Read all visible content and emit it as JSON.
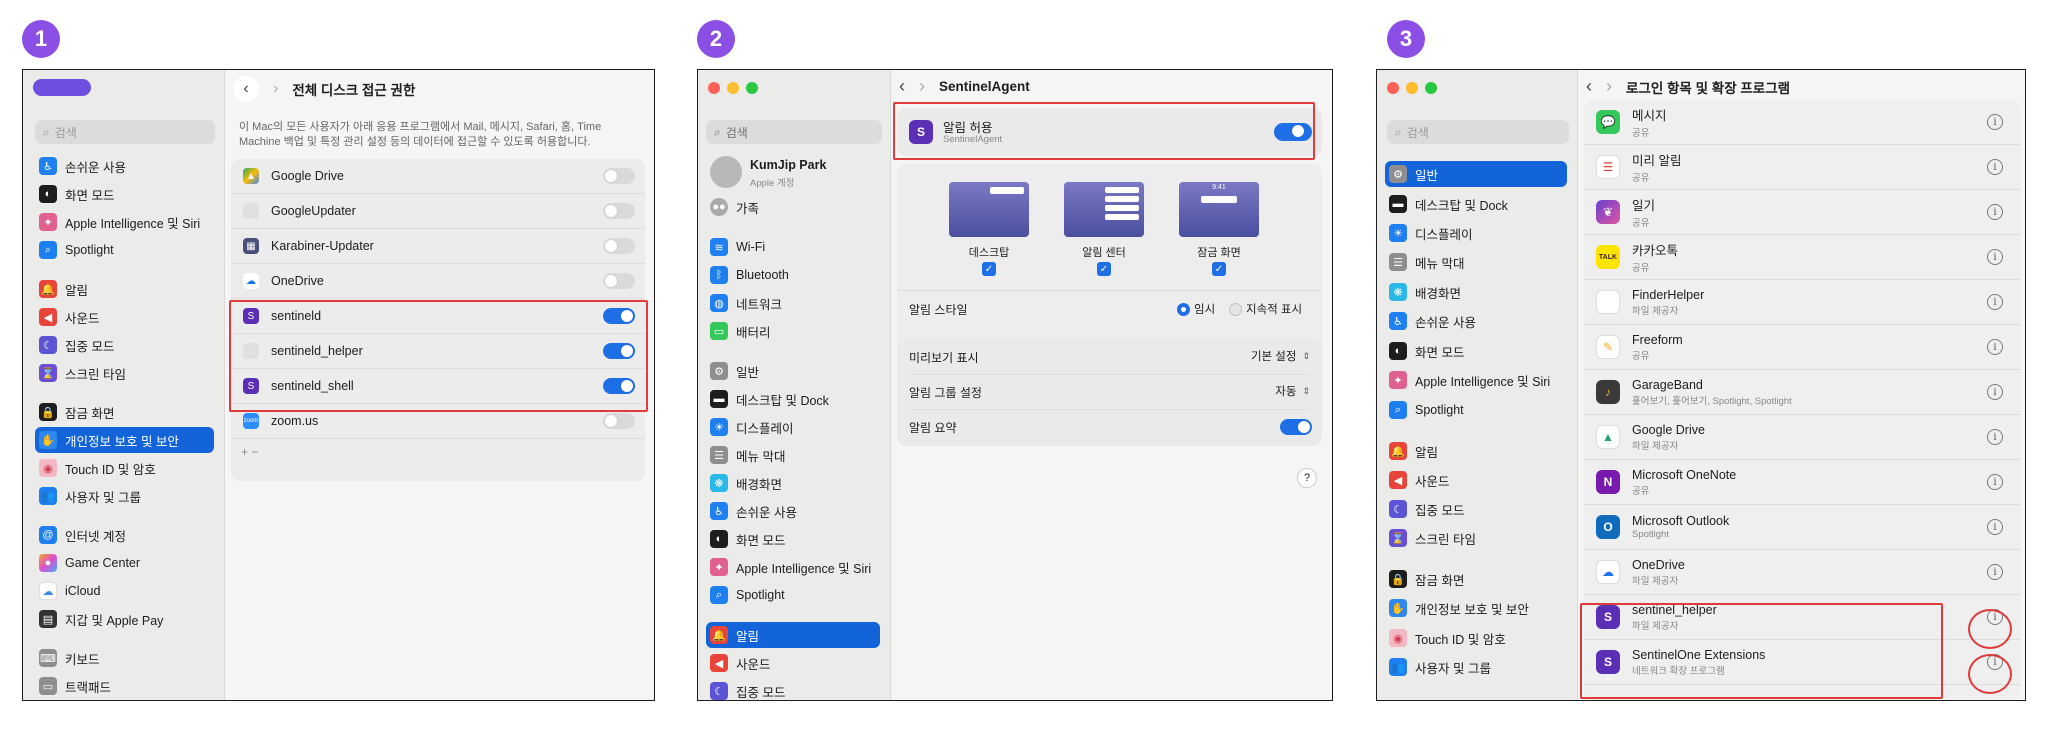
{
  "steps": [
    "1",
    "2",
    "3"
  ],
  "panel1": {
    "title": "전체 디스크 접근 권한",
    "search": "검색",
    "description": "이 Mac의 모든 사용자가 아래 응용 프로그램에서 Mail, 메시지, Safari, 홈, Time Machine 백업 및 특정 관리 설정 등의 데이터에 접근할 수 있도록 허용합니다.",
    "sidebar": [
      "손쉬운 사용",
      "화면 모드",
      "Apple Intelligence 및 Siri",
      "Spotlight",
      "알림",
      "사운드",
      "집중 모드",
      "스크린 타임",
      "잠금 화면",
      "개인정보 보호 및 보안",
      "Touch ID 및 암호",
      "사용자 및 그룹",
      "인터넷 계정",
      "Game Center",
      "iCloud",
      "지갑 및 Apple Pay",
      "키보드",
      "트랙패드"
    ],
    "apps": [
      {
        "name": "Google Drive",
        "on": false
      },
      {
        "name": "GoogleUpdater",
        "on": false
      },
      {
        "name": "Karabiner-Updater",
        "on": false
      },
      {
        "name": "OneDrive",
        "on": false
      },
      {
        "name": "sentineld",
        "on": true
      },
      {
        "name": "sentineld_helper",
        "on": true
      },
      {
        "name": "sentineld_shell",
        "on": true
      },
      {
        "name": "zoom.us",
        "on": false
      }
    ],
    "add_remove": "+   −"
  },
  "panel2": {
    "title": "SentinelAgent",
    "search": "검색",
    "user_name": "KumJip Park",
    "user_sub": "Apple 계정",
    "family": "가족",
    "sidebar": [
      "Wi-Fi",
      "Bluetooth",
      "네트워크",
      "배터리",
      "일반",
      "데스크탑 및 Dock",
      "디스플레이",
      "메뉴 막대",
      "배경화면",
      "손쉬운 사용",
      "화면 모드",
      "Apple Intelligence 및 Siri",
      "Spotlight",
      "알림",
      "사운드",
      "집중 모드"
    ],
    "allow_label": "알림 허용",
    "allow_sub": "SentinelAgent",
    "previews": [
      "데스크탑",
      "알림 센터",
      "잠금 화면"
    ],
    "preview_time": "9:41",
    "style_label": "알림 스타일",
    "style_opt1": "임시",
    "style_opt2": "지속적 표시",
    "show_preview_label": "미리보기 표시",
    "show_preview_value": "기본 설정",
    "grouping_label": "알림 그룹 설정",
    "grouping_value": "자동",
    "summary_label": "알림 요약",
    "help": "?"
  },
  "panel3": {
    "title": "로그인 항목 및 확장 프로그램",
    "search": "검색",
    "sidebar": [
      "일반",
      "데스크탑 및 Dock",
      "디스플레이",
      "메뉴 막대",
      "배경화면",
      "손쉬운 사용",
      "화면 모드",
      "Apple Intelligence 및 Siri",
      "Spotlight",
      "알림",
      "사운드",
      "집중 모드",
      "스크린 타임",
      "잠금 화면",
      "개인정보 보호 및 보안",
      "Touch ID 및 암호",
      "사용자 및 그룹"
    ],
    "items": [
      {
        "name": "메시지",
        "sub": "공유"
      },
      {
        "name": "미리 알림",
        "sub": "공유"
      },
      {
        "name": "일기",
        "sub": "공유"
      },
      {
        "name": "카카오톡",
        "sub": "공유"
      },
      {
        "name": "FinderHelper",
        "sub": "파일 제공자"
      },
      {
        "name": "Freeform",
        "sub": "공유"
      },
      {
        "name": "GarageBand",
        "sub": "훑어보기, 훑어보기, Spotlight, Spotlight"
      },
      {
        "name": "Google Drive",
        "sub": "파일 제공자"
      },
      {
        "name": "Microsoft OneNote",
        "sub": "공유"
      },
      {
        "name": "Microsoft Outlook",
        "sub": "Spotlight"
      },
      {
        "name": "OneDrive",
        "sub": "파일 제공자"
      },
      {
        "name": "sentinel_helper",
        "sub": "파일 제공자"
      },
      {
        "name": "SentinelOne Extensions",
        "sub": "네트워크 확장 프로그램"
      }
    ],
    "kakao_icon": "TALK"
  },
  "colors": {
    "accent": "#1264d8",
    "badge": "#8b4fe6",
    "highlight": "#e13a3a"
  }
}
